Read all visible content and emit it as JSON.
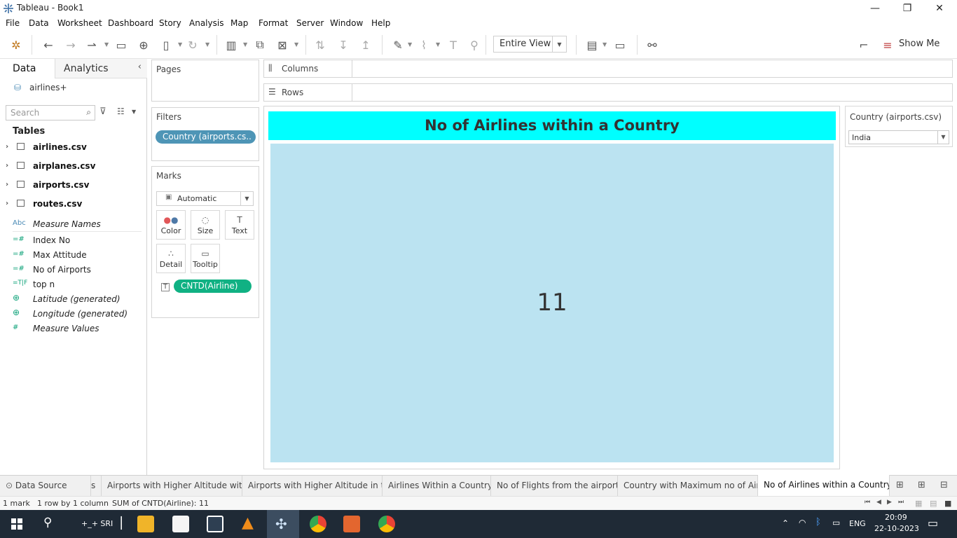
{
  "window": {
    "title": "Tableau - Book1",
    "minimize": "—",
    "restore": "❐",
    "close": "✕"
  },
  "menu": [
    "File",
    "Data",
    "Worksheet",
    "Dashboard",
    "Story",
    "Analysis",
    "Map",
    "Format",
    "Server",
    "Window",
    "Help"
  ],
  "toolbar": {
    "fit_value": "Entire View",
    "show_me": "Show Me"
  },
  "data_pane": {
    "tab_data": "Data",
    "tab_analytics": "Analytics",
    "datasource": "airlines+",
    "search_placeholder": "Search",
    "tables_heading": "Tables",
    "tables": [
      "airlines.csv",
      "airplanes.csv",
      "airports.csv",
      "routes.csv"
    ],
    "fields": [
      {
        "type": "Abc",
        "name": "Measure Names",
        "italic": true
      },
      {
        "type": "=#",
        "name": "Index No",
        "italic": false
      },
      {
        "type": "=#",
        "name": "Max Attitude",
        "italic": false
      },
      {
        "type": "=#",
        "name": "No of Airports",
        "italic": false
      },
      {
        "type": "=T|F",
        "name": "top n",
        "italic": false
      },
      {
        "type": "globe",
        "name": "Latitude (generated)",
        "italic": true
      },
      {
        "type": "globe",
        "name": "Longitude (generated)",
        "italic": true
      },
      {
        "type": "#",
        "name": "Measure Values",
        "italic": true
      }
    ]
  },
  "shelves": {
    "pages": "Pages",
    "filters": "Filters",
    "filter_pill": "Country (airports.cs..",
    "marks": "Marks",
    "mark_type": "Automatic",
    "mark_buttons": [
      "Color",
      "Size",
      "Text",
      "Detail",
      "Tooltip"
    ],
    "marks_pill": "CNTD(Airline)",
    "columns": "Columns",
    "rows": "Rows"
  },
  "view": {
    "title": "No of Airlines within a Country",
    "value": "11"
  },
  "country_filter": {
    "label": "Country (airports.csv)",
    "value": "India"
  },
  "sheet_tabs": [
    {
      "label": "Data Source",
      "active": false
    },
    {
      "label": "s",
      "active": false
    },
    {
      "label": "Airports with Higher Altitude wit...",
      "active": false
    },
    {
      "label": "Airports with Higher Altitude in t...",
      "active": false
    },
    {
      "label": "Airlines Within a Country",
      "active": false
    },
    {
      "label": "No of Flights from the airport",
      "active": false
    },
    {
      "label": "Country with Maximum no of Air...",
      "active": false
    },
    {
      "label": "No of Airlines within a Country",
      "active": true
    }
  ],
  "status": {
    "marks": "1 mark",
    "rows_cols": "1 row by 1 column",
    "sum": "SUM of CNTD(Airline): 11"
  },
  "taskbar": {
    "user": "+_+ SRI",
    "lang": "ENG",
    "time": "20:09",
    "date": "22-10-2023"
  },
  "colors": {
    "title_bg": "#00ffff",
    "view_bg": "#bbe3f1",
    "filter_pill": "#4e95b6",
    "marks_pill": "#10b183",
    "taskbar": "#1f2a36"
  }
}
